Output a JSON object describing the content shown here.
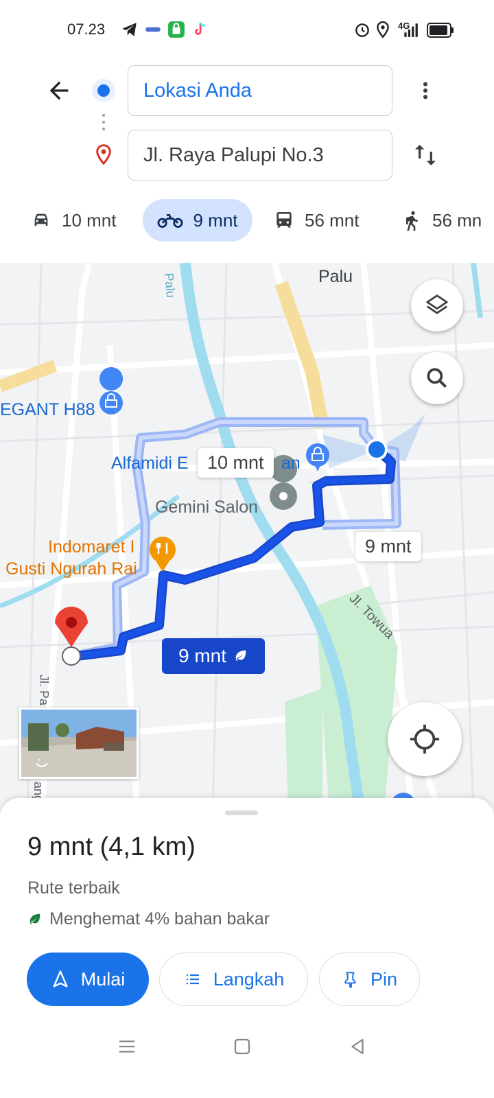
{
  "status_bar": {
    "time": "07.23",
    "network": "4G"
  },
  "directions": {
    "origin": "Lokasi Anda",
    "destination": "Jl. Raya Palupi No.3"
  },
  "modes": [
    {
      "icon": "car-icon",
      "label": "10 mnt",
      "selected": false
    },
    {
      "icon": "motorcycle-icon",
      "label": "9 mnt",
      "selected": true
    },
    {
      "icon": "transit-icon",
      "label": "56 mnt",
      "selected": false
    },
    {
      "icon": "walk-icon",
      "label": "56 mn",
      "selected": false
    }
  ],
  "map": {
    "labels": {
      "palu": "Palu",
      "palu_river": "Palu",
      "elegant": "EGANT H88",
      "alfamidi": "Alfamidi E",
      "alfamidi_tail": "an",
      "gemini": "Gemini Salon",
      "indomaret_1": "Indomaret I",
      "indomaret_2": "Gusti Ngurah Rai",
      "towua": "Jl. Towua",
      "jl_left": "Jl. Pa",
      "jl_left_bottom": "ang"
    },
    "route_bubbles": {
      "alt_car": "10 mnt",
      "alt_right": "9 mnt",
      "selected": "9 mnt"
    },
    "colors": {
      "route_main": "#1a53e8",
      "route_alt": "#9db6f5",
      "water": "#9fdcf0",
      "park": "#c9eed2"
    }
  },
  "sheet": {
    "summary": "9 mnt (4,1 km)",
    "route_label": "Rute terbaik",
    "fuel_text": "Menghemat 4% bahan bakar",
    "buttons": {
      "start": "Mulai",
      "steps": "Langkah",
      "pin": "Pin"
    }
  },
  "colors": {
    "accent": "#1a73e8",
    "selected_mode_bg": "#d3e3fd",
    "destination_pin": "#ea4335"
  }
}
